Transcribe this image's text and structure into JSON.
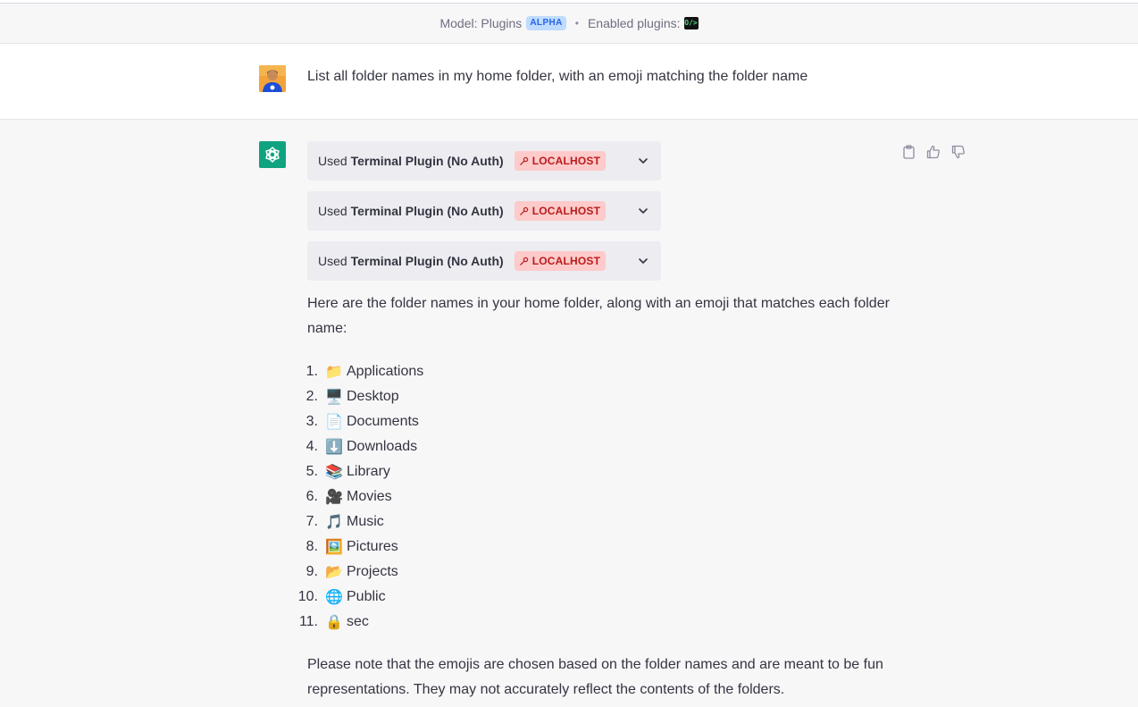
{
  "header": {
    "model_label": "Model: Plugins",
    "model_badge": "ALPHA",
    "separator": "•",
    "enabled_label": "Enabled plugins:",
    "plugin_logo_text": "O/>"
  },
  "user_message": {
    "text": "List all folder names in my home folder, with an emoji matching the folder name"
  },
  "plugin_calls": [
    {
      "prefix": "Used",
      "name": "Terminal Plugin (No Auth)",
      "badge": "LOCALHOST"
    },
    {
      "prefix": "Used",
      "name": "Terminal Plugin (No Auth)",
      "badge": "LOCALHOST"
    },
    {
      "prefix": "Used",
      "name": "Terminal Plugin (No Auth)",
      "badge": "LOCALHOST"
    }
  ],
  "assistant_message": {
    "intro": "Here are the folder names in your home folder, along with an emoji that matches each folder name:",
    "folders": [
      {
        "num": "1.",
        "emoji": "📁",
        "name": "Applications"
      },
      {
        "num": "2.",
        "emoji": "🖥️",
        "name": "Desktop"
      },
      {
        "num": "3.",
        "emoji": "📄",
        "name": "Documents"
      },
      {
        "num": "4.",
        "emoji": "⬇️",
        "name": "Downloads"
      },
      {
        "num": "5.",
        "emoji": "📚",
        "name": "Library"
      },
      {
        "num": "6.",
        "emoji": "🎥",
        "name": "Movies"
      },
      {
        "num": "7.",
        "emoji": "🎵",
        "name": "Music"
      },
      {
        "num": "8.",
        "emoji": "🖼️",
        "name": "Pictures"
      },
      {
        "num": "9.",
        "emoji": "📂",
        "name": "Projects"
      },
      {
        "num": "10.",
        "emoji": "🌐",
        "name": "Public"
      },
      {
        "num": "11.",
        "emoji": "🔒",
        "name": "sec"
      }
    ],
    "outro": "Please note that the emojis are chosen based on the folder names and are meant to be fun representations. They may not accurately reflect the contents of the folders."
  },
  "icons": {
    "copy": "clipboard-icon",
    "like": "thumbs-up-icon",
    "dislike": "thumbs-down-icon",
    "expand": "chevron-down-icon",
    "badge": "wrench-icon"
  },
  "colors": {
    "gpt_brand": "#10a37f",
    "badge_red_bg": "#fecaca",
    "badge_red_text": "#b91c1c",
    "alpha_bg": "#bfdbfe",
    "alpha_text": "#2563eb"
  }
}
